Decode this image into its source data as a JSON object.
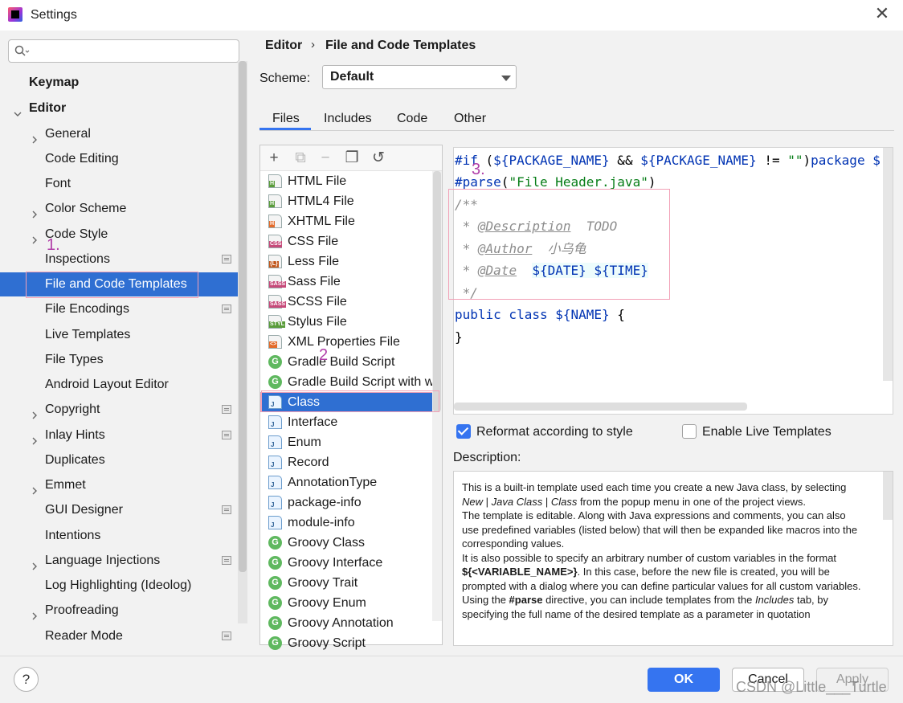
{
  "window": {
    "title": "Settings",
    "close_glyph": "✕"
  },
  "sidebar": {
    "search_placeholder": "",
    "items": [
      {
        "label": "Keymap",
        "bold": true,
        "chevron": "",
        "gear": false
      },
      {
        "label": "Editor",
        "bold": true,
        "chevron": "down",
        "gear": false
      },
      {
        "label": "General",
        "chevron": "right",
        "gear": false
      },
      {
        "label": "Code Editing",
        "chevron": "",
        "gear": false
      },
      {
        "label": "Font",
        "chevron": "",
        "gear": false
      },
      {
        "label": "Color Scheme",
        "chevron": "right",
        "gear": false
      },
      {
        "label": "Code Style",
        "chevron": "right",
        "gear": false
      },
      {
        "label": "Inspections",
        "chevron": "",
        "gear": true
      },
      {
        "label": "File and Code Templates",
        "chevron": "",
        "gear": false,
        "selected": true
      },
      {
        "label": "File Encodings",
        "chevron": "",
        "gear": true
      },
      {
        "label": "Live Templates",
        "chevron": "",
        "gear": false
      },
      {
        "label": "File Types",
        "chevron": "",
        "gear": false
      },
      {
        "label": "Android Layout Editor",
        "chevron": "",
        "gear": false
      },
      {
        "label": "Copyright",
        "chevron": "right",
        "gear": true
      },
      {
        "label": "Inlay Hints",
        "chevron": "right",
        "gear": true
      },
      {
        "label": "Duplicates",
        "chevron": "",
        "gear": false
      },
      {
        "label": "Emmet",
        "chevron": "right",
        "gear": false
      },
      {
        "label": "GUI Designer",
        "chevron": "",
        "gear": true
      },
      {
        "label": "Intentions",
        "chevron": "",
        "gear": false
      },
      {
        "label": "Language Injections",
        "chevron": "right",
        "gear": true
      },
      {
        "label": "Log Highlighting (Ideolog)",
        "chevron": "",
        "gear": false
      },
      {
        "label": "Proofreading",
        "chevron": "right",
        "gear": false
      },
      {
        "label": "Reader Mode",
        "chevron": "",
        "gear": true
      }
    ]
  },
  "breadcrumb": {
    "parent": "Editor",
    "separator": "›",
    "current": "File and Code Templates"
  },
  "scheme": {
    "label": "Scheme:",
    "value": "Default"
  },
  "tabs": [
    {
      "label": "Files",
      "active": true
    },
    {
      "label": "Includes"
    },
    {
      "label": "Code"
    },
    {
      "label": "Other"
    }
  ],
  "toolbar": {
    "add": "+",
    "copy": "⧉",
    "remove": "−",
    "duplicate": "❐",
    "reset": "↺"
  },
  "templates": [
    {
      "label": "HTML File",
      "icon": "html-file-icon",
      "kind": "doc",
      "tag": "H",
      "tag_color": "#5a9c3b"
    },
    {
      "label": "HTML4 File",
      "icon": "html-file-icon",
      "kind": "doc",
      "tag": "H",
      "tag_color": "#5a9c3b"
    },
    {
      "label": "XHTML File",
      "icon": "xhtml-file-icon",
      "kind": "doc",
      "tag": "H",
      "tag_color": "#e36b2b"
    },
    {
      "label": "CSS File",
      "icon": "css-file-icon",
      "kind": "doc",
      "tag": "CSS",
      "tag_color": "#c64a7a"
    },
    {
      "label": "Less File",
      "icon": "less-file-icon",
      "kind": "doc",
      "tag": "{L}",
      "tag_color": "#c2581d"
    },
    {
      "label": "Sass File",
      "icon": "sass-file-icon",
      "kind": "doc",
      "tag": "SASS",
      "tag_color": "#c64a7a"
    },
    {
      "label": "SCSS File",
      "icon": "scss-file-icon",
      "kind": "doc",
      "tag": "SASS",
      "tag_color": "#c64a7a"
    },
    {
      "label": "Stylus File",
      "icon": "stylus-file-icon",
      "kind": "doc",
      "tag": "STYL",
      "tag_color": "#5a9c3b"
    },
    {
      "label": "XML Properties File",
      "icon": "xml-file-icon",
      "kind": "doc",
      "tag": "<>",
      "tag_color": "#e36b2b"
    },
    {
      "label": "Gradle Build Script",
      "icon": "gradle-icon",
      "kind": "circ"
    },
    {
      "label": "Gradle Build Script with wr",
      "icon": "gradle-icon",
      "kind": "circ"
    },
    {
      "label": "Class",
      "icon": "java-class-icon",
      "kind": "java",
      "selected": true
    },
    {
      "label": "Interface",
      "icon": "java-interface-icon",
      "kind": "java"
    },
    {
      "label": "Enum",
      "icon": "java-enum-icon",
      "kind": "java"
    },
    {
      "label": "Record",
      "icon": "java-record-icon",
      "kind": "java"
    },
    {
      "label": "AnnotationType",
      "icon": "java-annotation-icon",
      "kind": "java"
    },
    {
      "label": "package-info",
      "icon": "java-file-icon",
      "kind": "java"
    },
    {
      "label": "module-info",
      "icon": "java-file-icon",
      "kind": "java"
    },
    {
      "label": "Groovy Class",
      "icon": "groovy-icon",
      "kind": "circ"
    },
    {
      "label": "Groovy Interface",
      "icon": "groovy-icon",
      "kind": "circ"
    },
    {
      "label": "Groovy Trait",
      "icon": "groovy-icon",
      "kind": "circ"
    },
    {
      "label": "Groovy Enum",
      "icon": "groovy-icon",
      "kind": "circ"
    },
    {
      "label": "Groovy Annotation",
      "icon": "groovy-icon",
      "kind": "circ"
    },
    {
      "label": "Groovy Script",
      "icon": "groovy-icon",
      "kind": "circ"
    }
  ],
  "editor": {
    "line1_kw": "#if",
    "line1_a": " (",
    "line1_v1": "${PACKAGE_NAME}",
    "line1_b": " && ",
    "line1_v2": "${PACKAGE_NAME}",
    "line1_c": " != ",
    "line1_s": "\"\"",
    "line1_d": ")",
    "line1_kw2": "package",
    "line1_e": " ",
    "line1_v3": "$",
    "line2_kw": "#parse",
    "line2_a": "(",
    "line2_s": "\"File Header.java\"",
    "line2_b": ")",
    "line3": "/**",
    "line4_a": " * ",
    "line4_tag": "@Description",
    "line4_b": "  TODO",
    "line5_a": " * ",
    "line5_tag": "@Author",
    "line5_b": "  小乌龟",
    "line6_a": " * ",
    "line6_tag": "@Date",
    "line6_b": "  ",
    "line6_v": "${DATE} ${TIME}",
    "line7": " */",
    "line8_kw": "public class",
    "line8_a": " ",
    "line8_v": "${NAME}",
    "line8_b": " {",
    "line9": "}"
  },
  "annotations": {
    "a1": "1.",
    "a2": "2",
    "a3": "3."
  },
  "options": {
    "reformat_label": "Reformat according to style",
    "reformat_checked": true,
    "live_label": "Enable Live Templates",
    "live_checked": false
  },
  "description": {
    "label": "Description:",
    "p1a": "This is a built-in template used each time you create a new Java class, by selecting ",
    "p1i1": "New",
    "p1s1": " | ",
    "p1i2": "Java Class",
    "p1s2": " | ",
    "p1i3": "Class",
    "p1b": " from the popup menu in one of the project views.",
    "p2": "The template is editable. Along with Java expressions and comments, you can also use predefined variables (listed below) that will then be expanded like macros into the corresponding values.",
    "p3a": "It is also possible to specify an arbitrary number of custom variables in the format ",
    "p3b": "${<VARIABLE_NAME>}",
    "p3c": ". In this case, before the new file is created, you will be prompted with a dialog where you can define particular values for all custom variables.",
    "p4a": "Using the ",
    "p4b": "#parse",
    "p4c": " directive, you can include templates from the ",
    "p4d": "Includes",
    "p4e": " tab, by specifying the full name of the desired template as a parameter in quotation"
  },
  "footer": {
    "help": "?",
    "ok": "OK",
    "cancel": "Cancel",
    "apply": "Apply"
  },
  "watermark": "CSDN @Little___Turtle",
  "colors": {
    "accent": "#3574f0",
    "selection": "#2f6fd2",
    "annotation": "#b03ea8",
    "highlight_box": "#f2a0b6"
  }
}
